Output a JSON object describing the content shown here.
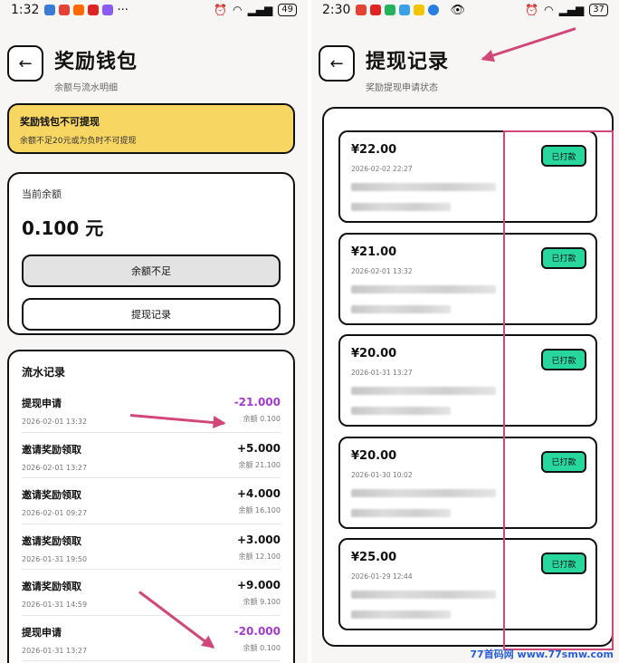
{
  "left": {
    "status": {
      "time": "1:32",
      "battery": "49"
    },
    "header": {
      "title": "奖励钱包",
      "subtitle": "余额与流水明细"
    },
    "warning": {
      "title": "奖励钱包不可提现",
      "desc": "余额不足20元或为负时不可提现"
    },
    "balance": {
      "label": "当前余额",
      "amount": "0.100 元",
      "insufficient_button": "余额不足",
      "records_button": "提现记录"
    },
    "flow": {
      "title": "流水记录",
      "rows": [
        {
          "name": "提现申请",
          "date": "2026-02-01 13:32",
          "amount": "-21.000",
          "balance": "余额 0.100",
          "negative": true
        },
        {
          "name": "邀请奖励领取",
          "date": "2026-02-01 13:27",
          "amount": "+5.000",
          "balance": "余额 21.100",
          "negative": false
        },
        {
          "name": "邀请奖励领取",
          "date": "2026-02-01 09:27",
          "amount": "+4.000",
          "balance": "余额 16.100",
          "negative": false
        },
        {
          "name": "邀请奖励领取",
          "date": "2026-01-31 19:50",
          "amount": "+3.000",
          "balance": "余额 12.100",
          "negative": false
        },
        {
          "name": "邀请奖励领取",
          "date": "2026-01-31 14:59",
          "amount": "+9.000",
          "balance": "余额 9.100",
          "negative": false
        },
        {
          "name": "提现申请",
          "date": "2026-01-31 13:27",
          "amount": "-20.000",
          "balance": "余额 0.100",
          "negative": true
        }
      ]
    }
  },
  "right": {
    "status": {
      "time": "2:30",
      "battery": "37"
    },
    "header": {
      "title": "提现记录",
      "subtitle": "奖励提现申请状态"
    },
    "records": [
      {
        "amount": "¥22.00",
        "date": "2026-02-02 22:27",
        "status": "已打款"
      },
      {
        "amount": "¥21.00",
        "date": "2026-02-01 13:32",
        "status": "已打款"
      },
      {
        "amount": "¥20.00",
        "date": "2026-01-31 13:27",
        "status": "已打款"
      },
      {
        "amount": "¥20.00",
        "date": "2026-01-30 10:02",
        "status": "已打款"
      },
      {
        "amount": "¥25.00",
        "date": "2026-01-29 12:44",
        "status": "已打款"
      }
    ]
  },
  "watermark": "77首码网 www.77smw.com",
  "colors": {
    "warning_bg": "#f8d662",
    "status_green": "#28d79e",
    "negative_purple": "#a33bd1",
    "annotation_pink": "#d2477a"
  }
}
